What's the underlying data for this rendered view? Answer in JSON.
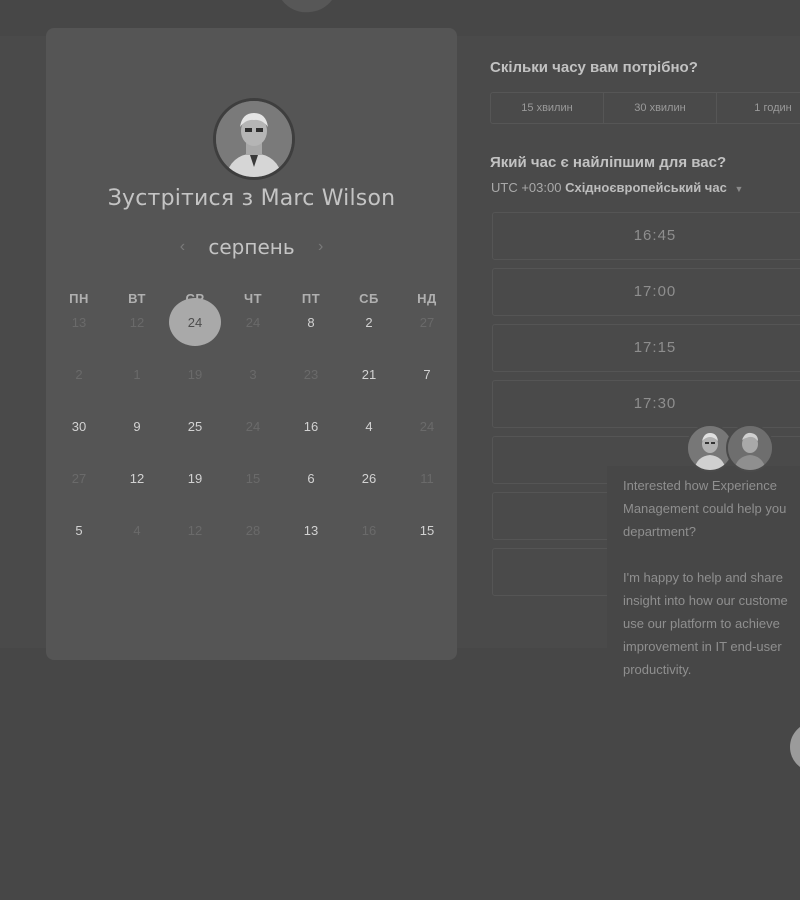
{
  "host": {
    "title": "Зустрітися з Marc Wilson"
  },
  "calendar": {
    "month": "серпень",
    "weekdays": [
      "ПН",
      "ВТ",
      "СР",
      "ЧТ",
      "ПТ",
      "СБ",
      "НД"
    ],
    "weeks": [
      [
        {
          "d": "13",
          "s": "dim"
        },
        {
          "d": "12",
          "s": "dim"
        },
        {
          "d": "24",
          "s": "selected"
        },
        {
          "d": "24",
          "s": "dim"
        },
        {
          "d": "8",
          "s": "avail"
        },
        {
          "d": "2",
          "s": "avail"
        },
        {
          "d": "27",
          "s": "dim"
        }
      ],
      [
        {
          "d": "2",
          "s": "dim"
        },
        {
          "d": "1",
          "s": "dim"
        },
        {
          "d": "19",
          "s": "dim"
        },
        {
          "d": "3",
          "s": "dim"
        },
        {
          "d": "23",
          "s": "dim"
        },
        {
          "d": "21",
          "s": "avail"
        },
        {
          "d": "7",
          "s": "avail"
        }
      ],
      [
        {
          "d": "30",
          "s": "avail"
        },
        {
          "d": "9",
          "s": "avail"
        },
        {
          "d": "25",
          "s": "avail"
        },
        {
          "d": "24",
          "s": "dim"
        },
        {
          "d": "16",
          "s": "avail"
        },
        {
          "d": "4",
          "s": "avail"
        },
        {
          "d": "24",
          "s": "dim"
        }
      ],
      [
        {
          "d": "27",
          "s": "dim"
        },
        {
          "d": "12",
          "s": "avail"
        },
        {
          "d": "19",
          "s": "avail"
        },
        {
          "d": "15",
          "s": "dim"
        },
        {
          "d": "6",
          "s": "avail"
        },
        {
          "d": "26",
          "s": "avail"
        },
        {
          "d": "11",
          "s": "dim"
        }
      ],
      [
        {
          "d": "5",
          "s": "avail"
        },
        {
          "d": "4",
          "s": "dim"
        },
        {
          "d": "12",
          "s": "dim"
        },
        {
          "d": "28",
          "s": "dim"
        },
        {
          "d": "13",
          "s": "avail"
        },
        {
          "d": "16",
          "s": "dim"
        },
        {
          "d": "15",
          "s": "avail"
        }
      ]
    ]
  },
  "duration": {
    "title": "Скільки часу вам потрібно?",
    "options": [
      "15 хвилин",
      "30 хвилин",
      "1 годин"
    ]
  },
  "timeslots": {
    "title": "Який час є найліпшим для вас?",
    "tz_offset": "UTC +03:00",
    "tz_name": "Східноєвропейський час",
    "slots": [
      "16:45",
      "17:00",
      "17:15",
      "17:30"
    ]
  },
  "chat": {
    "message_lines": [
      "Interested how Experience",
      "Management could help you",
      "department?",
      "",
      "I'm happy to help and share",
      "insight into how our custome",
      "use our platform to achieve",
      "improvement in IT end-user",
      "productivity."
    ]
  },
  "colors": {
    "page_background": "#474747",
    "card_background": "#555555",
    "selected_day": "#a9a9a9"
  }
}
